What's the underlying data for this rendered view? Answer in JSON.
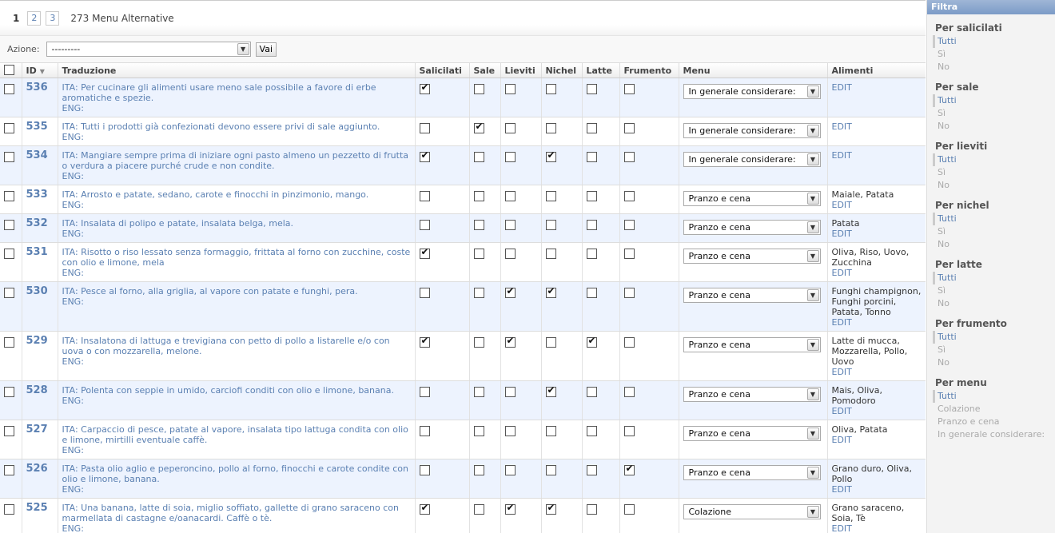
{
  "paginator": {
    "current": "1",
    "pages": [
      "2",
      "3"
    ],
    "count": "273 Menu Alternative"
  },
  "actions": {
    "label": "Azione:",
    "selected": "---------",
    "go": "Vai"
  },
  "columns": {
    "id": "ID",
    "traduzione": "Traduzione",
    "salicilati": "Salicilati",
    "sale": "Sale",
    "lieviti": "Lieviti",
    "nichel": "Nichel",
    "latte": "Latte",
    "frumento": "Frumento",
    "menu": "Menu",
    "alimenti": "Alimenti"
  },
  "rows": [
    {
      "id": "536",
      "ita": "ITA: Per cucinare gli alimenti usare meno sale possibile a favore di erbe aromatiche e spezie.",
      "eng": "ENG:",
      "flags": [
        1,
        0,
        0,
        0,
        0,
        0
      ],
      "menu": "In generale considerare:",
      "alimenti": "",
      "edit": "EDIT"
    },
    {
      "id": "535",
      "ita": "ITA: Tutti i prodotti già confezionati devono essere privi di sale aggiunto.",
      "eng": "ENG:",
      "flags": [
        0,
        1,
        0,
        0,
        0,
        0
      ],
      "menu": "In generale considerare:",
      "alimenti": "",
      "edit": "EDIT"
    },
    {
      "id": "534",
      "ita": "ITA: Mangiare sempre prima di iniziare ogni pasto almeno un pezzetto di frutta o verdura a piacere purché crude e non condite.",
      "eng": "ENG:",
      "flags": [
        1,
        0,
        0,
        1,
        0,
        0
      ],
      "menu": "In generale considerare:",
      "alimenti": "",
      "edit": "EDIT"
    },
    {
      "id": "533",
      "ita": "ITA: Arrosto e patate, sedano, carote e finocchi in pinzimonio, mango.",
      "eng": "ENG:",
      "flags": [
        0,
        0,
        0,
        0,
        0,
        0
      ],
      "menu": "Pranzo e cena",
      "alimenti": "Maiale, Patata",
      "edit": "EDIT"
    },
    {
      "id": "532",
      "ita": "ITA: Insalata di polipo e patate, insalata belga, mela.",
      "eng": "ENG:",
      "flags": [
        0,
        0,
        0,
        0,
        0,
        0
      ],
      "menu": "Pranzo e cena",
      "alimenti": "Patata",
      "edit": "EDIT"
    },
    {
      "id": "531",
      "ita": "ITA: Risotto o riso lessato senza formaggio, frittata al forno con zucchine, coste con olio e limone, mela",
      "eng": "ENG:",
      "flags": [
        1,
        0,
        0,
        0,
        0,
        0
      ],
      "menu": "Pranzo e cena",
      "alimenti": "Oliva, Riso, Uovo, Zucchina",
      "edit": "EDIT"
    },
    {
      "id": "530",
      "ita": "ITA: Pesce al forno, alla griglia, al vapore con patate e funghi, pera.",
      "eng": "ENG:",
      "flags": [
        0,
        0,
        1,
        1,
        0,
        0
      ],
      "menu": "Pranzo e cena",
      "alimenti": "Funghi champignon, Funghi porcini, Patata, Tonno",
      "edit": "EDIT"
    },
    {
      "id": "529",
      "ita": "ITA: Insalatona di lattuga e trevigiana con petto di pollo a listarelle e/o con uova o con mozzarella, melone.",
      "eng": "ENG:",
      "flags": [
        1,
        0,
        1,
        0,
        1,
        0
      ],
      "menu": "Pranzo e cena",
      "alimenti": "Latte di mucca, Mozzarella, Pollo, Uovo",
      "edit": "EDIT"
    },
    {
      "id": "528",
      "ita": "ITA: Polenta con seppie in umido, carciofi conditi con olio e limone, banana.",
      "eng": "ENG:",
      "flags": [
        0,
        0,
        0,
        1,
        0,
        0
      ],
      "menu": "Pranzo e cena",
      "alimenti": "Mais, Oliva, Pomodoro",
      "edit": "EDIT"
    },
    {
      "id": "527",
      "ita": "ITA: Carpaccio di pesce, patate al vapore, insalata tipo lattuga condita con olio e limone, mirtilli eventuale caffè.",
      "eng": "ENG:",
      "flags": [
        0,
        0,
        0,
        0,
        0,
        0
      ],
      "menu": "Pranzo e cena",
      "alimenti": "Oliva, Patata",
      "edit": "EDIT"
    },
    {
      "id": "526",
      "ita": "ITA: Pasta olio aglio e peperoncino, pollo al forno, finocchi e carote condite con olio e limone, banana.",
      "eng": "ENG:",
      "flags": [
        0,
        0,
        0,
        0,
        0,
        1
      ],
      "menu": "Pranzo e cena",
      "alimenti": "Grano duro, Oliva, Pollo",
      "edit": "EDIT"
    },
    {
      "id": "525",
      "ita": "ITA: Una banana, latte di soia, miglio soffiato, gallette di grano saraceno con marmellata di castagne e/oanacardi. Caffè o tè.",
      "eng": "ENG:",
      "flags": [
        1,
        0,
        1,
        1,
        0,
        0
      ],
      "menu": "Colazione",
      "alimenti": "Grano saraceno, Soia, Tè",
      "edit": "EDIT"
    }
  ],
  "filter": {
    "title": "Filtra",
    "groups": [
      {
        "heading": "Per salicilati",
        "options": [
          "Tutti",
          "Sì",
          "No"
        ]
      },
      {
        "heading": "Per sale",
        "options": [
          "Tutti",
          "Sì",
          "No"
        ]
      },
      {
        "heading": "Per lieviti",
        "options": [
          "Tutti",
          "Sì",
          "No"
        ]
      },
      {
        "heading": "Per nichel",
        "options": [
          "Tutti",
          "Sì",
          "No"
        ]
      },
      {
        "heading": "Per latte",
        "options": [
          "Tutti",
          "Sì",
          "No"
        ]
      },
      {
        "heading": "Per frumento",
        "options": [
          "Tutti",
          "Sì",
          "No"
        ]
      },
      {
        "heading": "Per menu",
        "options": [
          "Tutti",
          "Colazione",
          "Pranzo e cena",
          "In generale considerare:"
        ]
      }
    ]
  }
}
